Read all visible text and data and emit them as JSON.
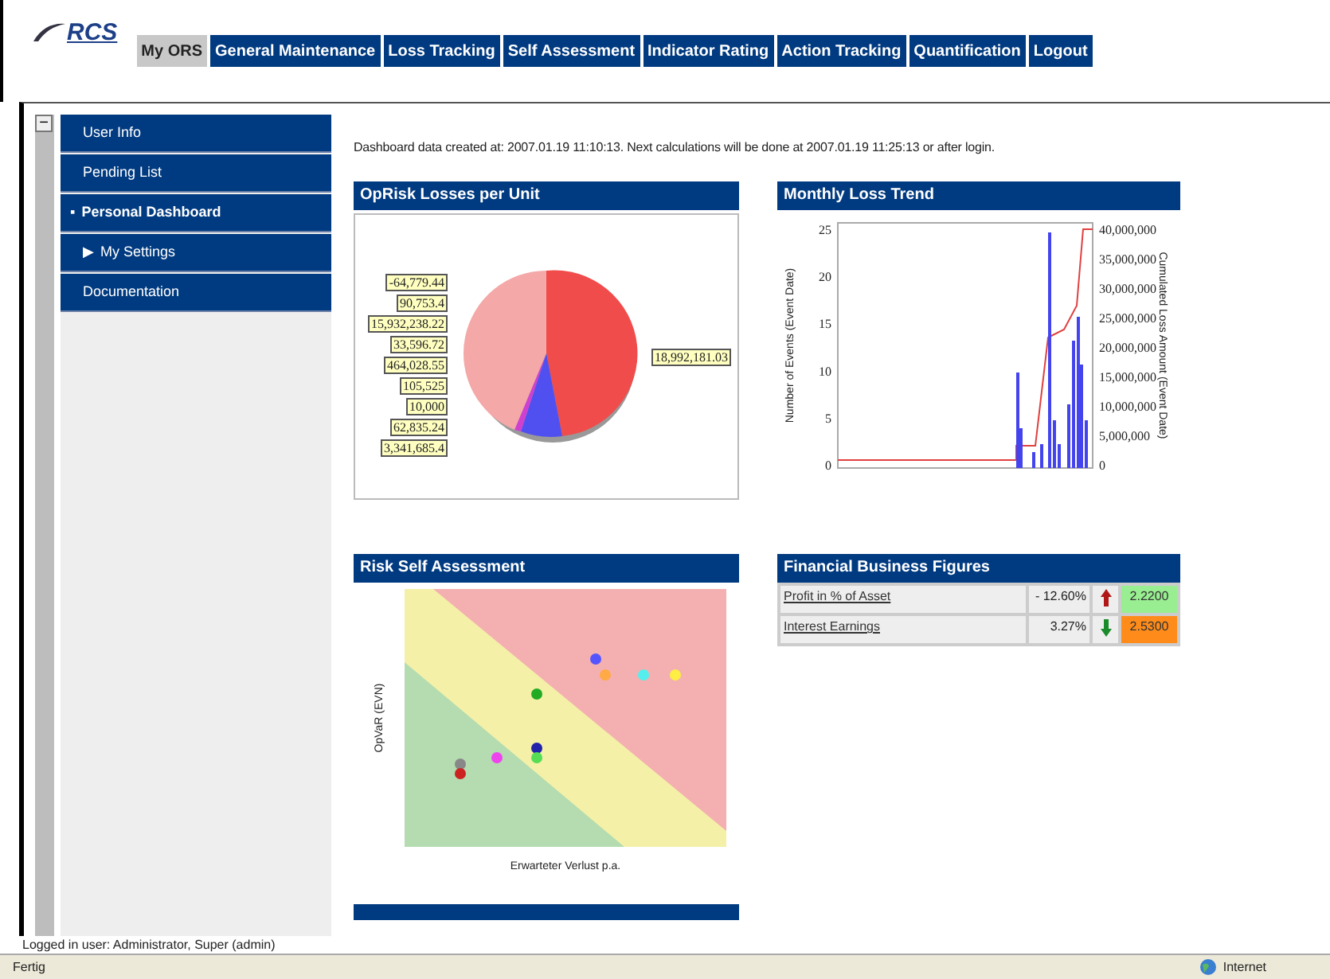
{
  "logo": {
    "text": "RCS"
  },
  "tabs": [
    {
      "label": "My ORS",
      "selected": true
    },
    {
      "label": "General Maintenance",
      "selected": false
    },
    {
      "label": "Loss Tracking",
      "selected": false
    },
    {
      "label": "Self Assessment",
      "selected": false
    },
    {
      "label": "Indicator Rating",
      "selected": false
    },
    {
      "label": "Action Tracking",
      "selected": false
    },
    {
      "label": "Quantification",
      "selected": false
    },
    {
      "label": "Logout",
      "selected": false
    }
  ],
  "collapse_button": "−",
  "sidebar": {
    "items": [
      {
        "label": "User Info",
        "marker": "",
        "selected": false
      },
      {
        "label": "Pending List",
        "marker": "",
        "selected": false
      },
      {
        "label": "Personal Dashboard",
        "marker": "▪",
        "selected": true
      },
      {
        "label": "My Settings",
        "marker": "▶",
        "selected": false
      },
      {
        "label": "Documentation",
        "marker": "",
        "selected": false
      }
    ]
  },
  "info": "Dashboard data created at: 2007.01.19 11:10:13. Next calculations will be done at 2007.01.19 11:25:13 or after login.",
  "oprisk": {
    "title": "OpRisk Losses per Unit",
    "left_callouts": [
      "-64,779.44",
      "90,753.4",
      "15,932,238.22",
      "33,596.72",
      "464,028.55",
      "105,525",
      "10,000",
      "62,835.24",
      "3,341,685.4"
    ],
    "right_callouts": [
      "18,992,181.03"
    ]
  },
  "trend": {
    "title": "Monthly Loss Trend",
    "ylabel": "Number of Events (Event Date)",
    "y2label": "Cumulated Loss Amount (Event Date)",
    "yticks": [
      "25",
      "20",
      "15",
      "10",
      "5",
      "0"
    ],
    "y2ticks": [
      "40,000,000",
      "35,000,000",
      "30,000,000",
      "25,000,000",
      "20,000,000",
      "15,000,000",
      "10,000,000",
      "5,000,000",
      "0"
    ]
  },
  "risk": {
    "title": "Risk Self Assessment",
    "xlabel": "Erwarteter Verlust p.a.",
    "ylabel": "OpVaR (EVN)"
  },
  "financial": {
    "title": "Financial Business Figures",
    "rows": [
      {
        "name": "Profit in % of Asset",
        "value": "- 12.60%",
        "kind": "up",
        "score": "2.2200",
        "color": "#98ee90"
      },
      {
        "name": "Interest Earnings",
        "value": "3.27%",
        "kind": "down",
        "score": "2.5300",
        "color": "#ff8c1a"
      }
    ]
  },
  "login_line": "Logged in user: Administrator, Super (admin)",
  "status_bar": {
    "text": "Fertig",
    "zone": "Internet"
  }
}
